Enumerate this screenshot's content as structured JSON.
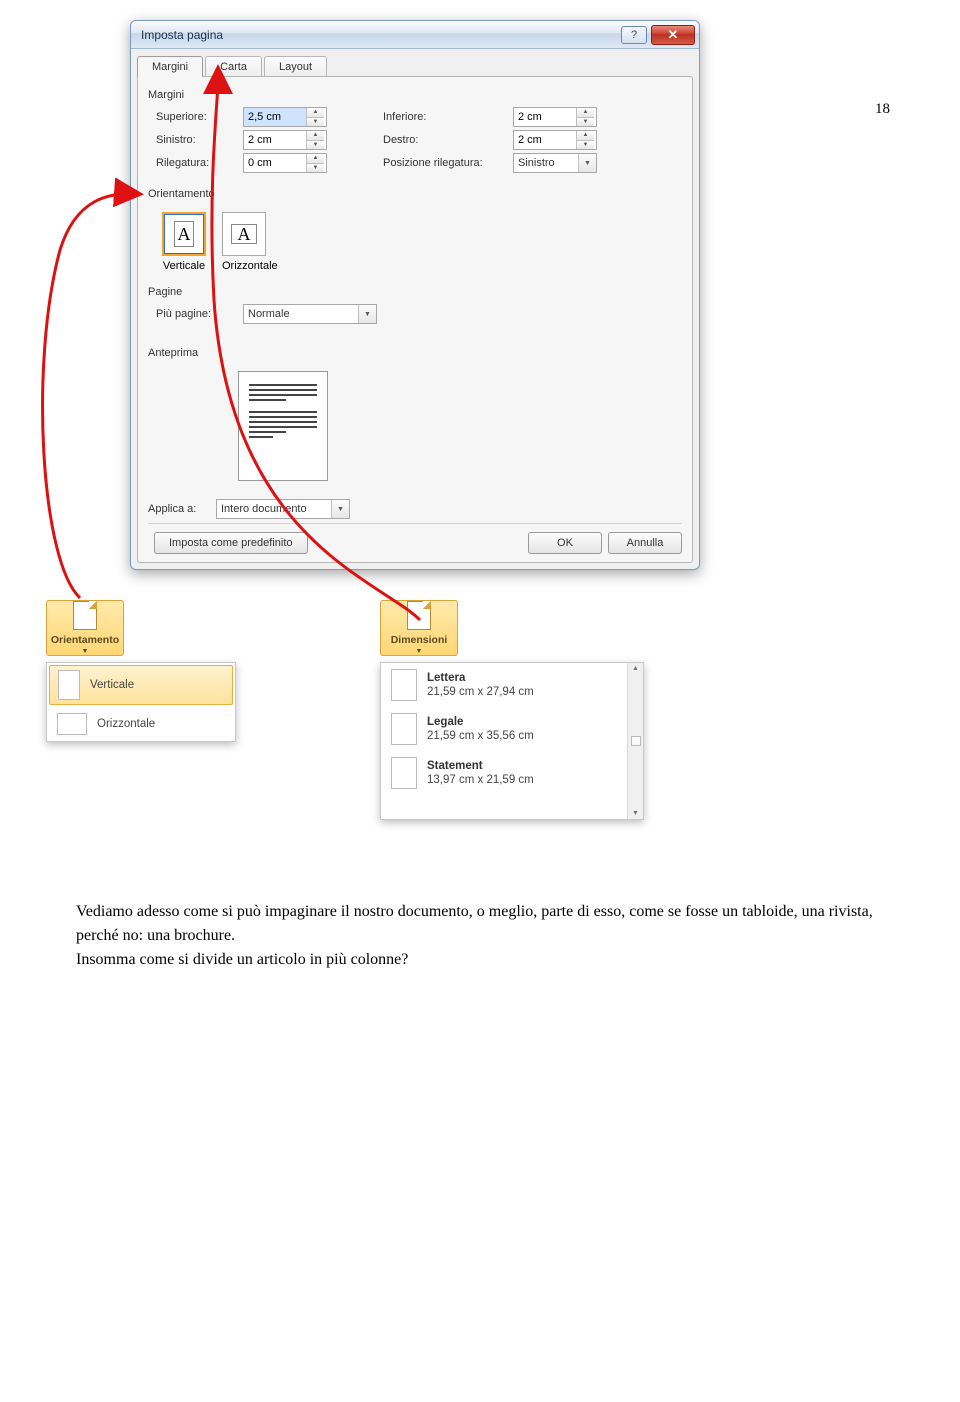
{
  "dialog": {
    "title": "Imposta pagina",
    "tabs": {
      "margini": "Margini",
      "carta": "Carta",
      "layout": "Layout"
    },
    "groups": {
      "margini": "Margini",
      "orientamento": "Orientamento",
      "pagine": "Pagine",
      "anteprima": "Anteprima"
    },
    "fields": {
      "superiore": {
        "label": "Superiore:",
        "value": "2,5 cm"
      },
      "inferiore": {
        "label": "Inferiore:",
        "value": "2 cm"
      },
      "sinistro": {
        "label": "Sinistro:",
        "value": "2 cm"
      },
      "destro": {
        "label": "Destro:",
        "value": "2 cm"
      },
      "rilegatura": {
        "label": "Rilegatura:",
        "value": "0 cm"
      },
      "posrileg": {
        "label": "Posizione rilegatura:",
        "value": "Sinistro"
      }
    },
    "orientOptions": {
      "verticale": "Verticale",
      "orizzontale": "Orizzontale"
    },
    "piu_pagine": {
      "label": "Più pagine:",
      "value": "Normale"
    },
    "applica_a": {
      "label": "Applica a:",
      "value": "Intero documento"
    },
    "buttons": {
      "predef": "Imposta come predefinito",
      "ok": "OK",
      "annulla": "Annulla"
    }
  },
  "ribbon": {
    "orientamento": {
      "caption": "Orientamento",
      "items": {
        "verticale": "Verticale",
        "orizzontale": "Orizzontale"
      }
    },
    "dimensioni": {
      "caption": "Dimensioni",
      "items": [
        {
          "title": "Lettera",
          "sub": "21,59 cm x 27,94 cm"
        },
        {
          "title": "Legale",
          "sub": "21,59 cm x 35,56 cm"
        },
        {
          "title": "Statement",
          "sub": "13,97 cm x 21,59 cm"
        }
      ]
    }
  },
  "paragraph": {
    "line1": "Vediamo adesso come si può impaginare il nostro documento, o meglio, parte di esso, come se fosse un tabloide, una rivista, perché no: una brochure.",
    "line2": "Insomma come si divide un articolo in più colonne?"
  },
  "page_number": "18"
}
